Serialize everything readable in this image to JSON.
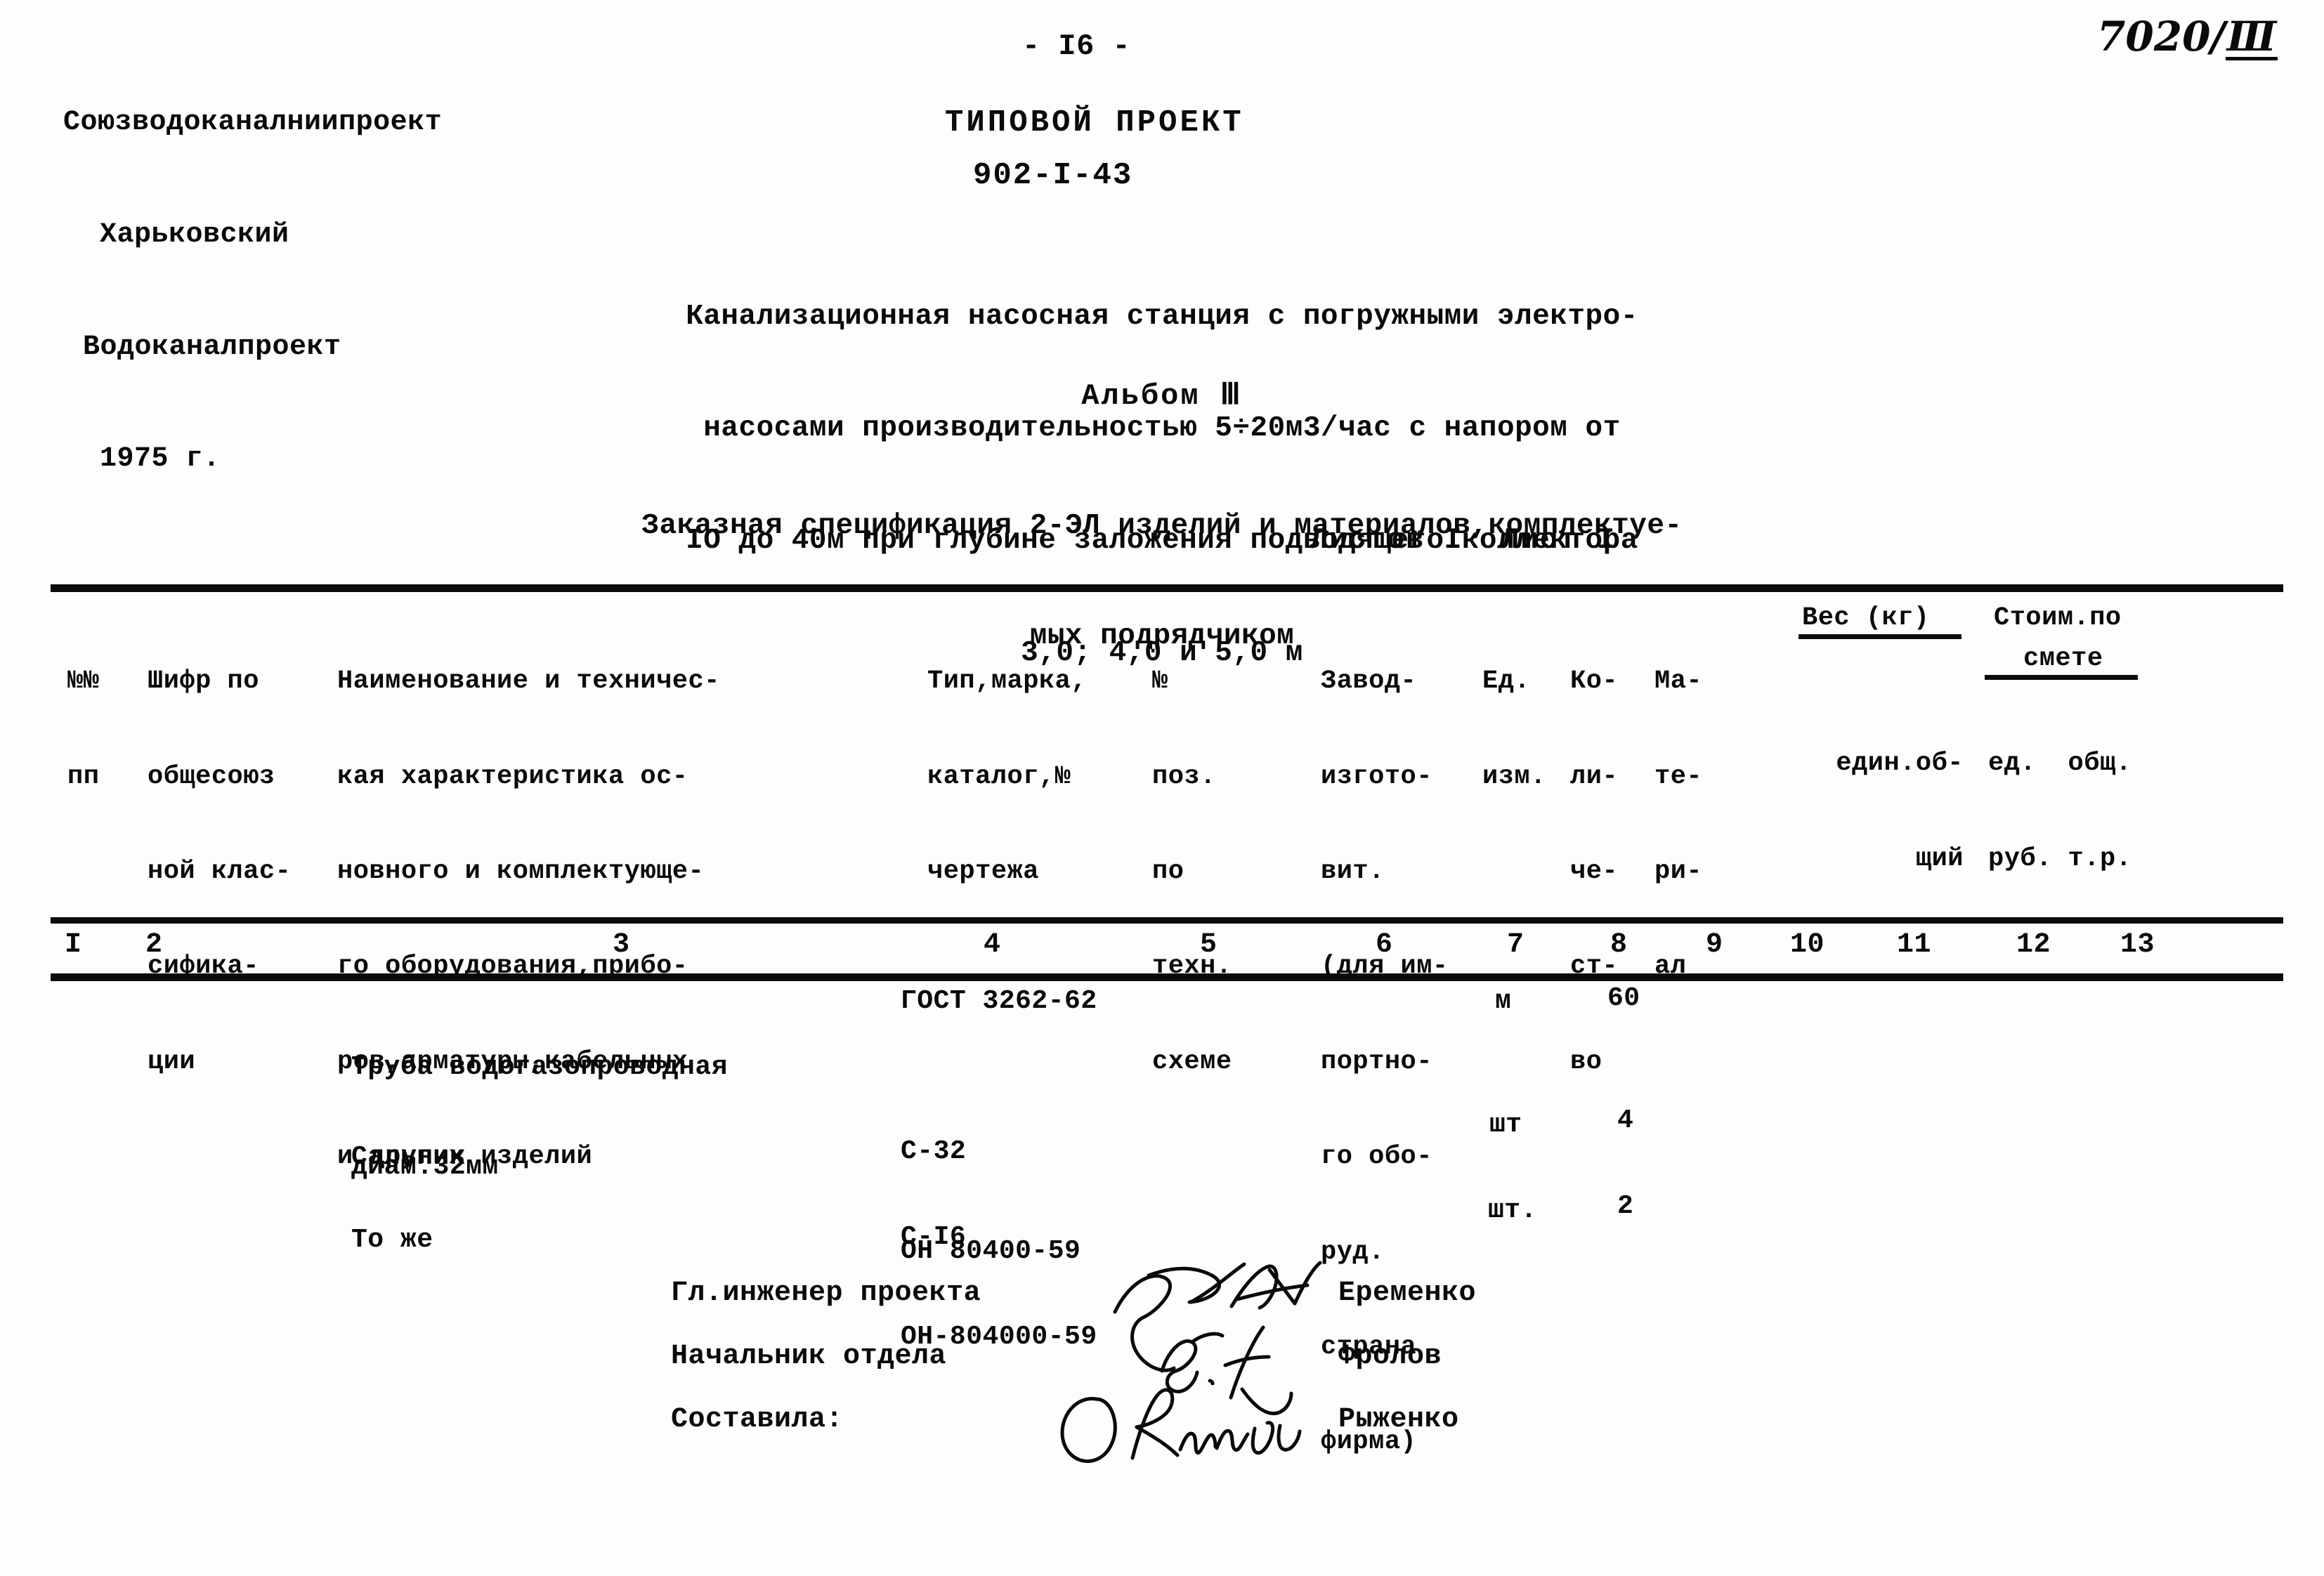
{
  "org": {
    "line1": "Союзводоканалниипроект",
    "line2": "Харьковский",
    "line3": "Водоканалпроект",
    "line4": "1975 г."
  },
  "header": {
    "page_number": "- I6 -",
    "doc_kind": "ТИПОВОЙ ПРОЕКТ",
    "doc_code": "902-I-43",
    "handwritten_number": "7020/",
    "handwritten_fraction_top": "Ⅲ",
    "description_lines": [
      "Канализационная насосная станция с погружными электро-",
      "насосами производительностью 5÷20м3/час с напором от",
      "IО до 40м при глубине заложения подводящего коллектора",
      "3,0; 4,0 и 5,0 м"
    ],
    "album": "Альбом Ⅲ",
    "spec_lines": [
      "Заказная спецификация 2-ЭЛ изделий и материалов,комплектуе-",
      "мых подрядчиком"
    ],
    "sheets": "Листов I  Лист I"
  },
  "table": {
    "columns": [
      {
        "num": "I",
        "header_lines": [
          "№№",
          "пп"
        ]
      },
      {
        "num": "2",
        "header_lines": [
          "Шифр по",
          "общесоюз",
          "ной клас-",
          "сифика-",
          "ции"
        ]
      },
      {
        "num": "3",
        "header_lines": [
          "Наименование и техничес-",
          "кая характеристика ос-",
          "новного и комплектующе-",
          "го оборудования,прибо-",
          "ров,арматуры,кабельных",
          "и других изделий"
        ]
      },
      {
        "num": "4",
        "header_lines": [
          "Тип,марка,",
          "каталог,№",
          "чертежа"
        ]
      },
      {
        "num": "5",
        "header_lines": [
          "№",
          "поз.",
          "по",
          "техн.",
          "схеме"
        ]
      },
      {
        "num": "6",
        "header_lines": [
          "Завод-",
          "изгото-",
          "вит.",
          "(для им-",
          "портно-",
          "го обо-",
          "руд.",
          "страна",
          "фирма)"
        ]
      },
      {
        "num": "7",
        "header_lines": [
          "Ед.",
          "изм."
        ]
      },
      {
        "num": "8",
        "header_lines": [
          "Ко-",
          "ли-",
          "че-",
          "ст-",
          "во"
        ]
      },
      {
        "num": "9",
        "header_lines": [
          "Ма-",
          "те-",
          "ри-",
          "ал"
        ]
      },
      {
        "num": "10",
        "header_lines": [
          "Вес (кг)"
        ],
        "sub": [
          "един.об-",
          "щий"
        ]
      },
      {
        "num": "11",
        "header_lines": []
      },
      {
        "num": "12",
        "header_lines": [
          "Стоим.по",
          "смете"
        ],
        "sub": [
          "ед.",
          "руб."
        ]
      },
      {
        "num": "13",
        "header_lines": [],
        "sub": [
          "общ.",
          "т.р."
        ]
      }
    ],
    "column_numbers": [
      "I",
      "2",
      "3",
      "4",
      "5",
      "6",
      "7",
      "8",
      "9",
      "10",
      "11",
      "12",
      "13"
    ],
    "rows": [
      {
        "name_lines": [
          "Труба водогазопроводная",
          "диам.32мм"
        ],
        "type_lines": [
          "ГОСТ 3262-62"
        ],
        "unit": "м",
        "qty": "60"
      },
      {
        "name_lines": [
          "Сальник"
        ],
        "type_lines": [
          "С-32",
          "ОН 80400-59"
        ],
        "unit": "шт",
        "qty": "4"
      },
      {
        "name_lines": [
          "То же"
        ],
        "type_lines": [
          "С-I6",
          "ОН-804000-59"
        ],
        "unit": "шт.",
        "qty": "2"
      }
    ]
  },
  "signatures": [
    {
      "role": "Гл.инженер проекта",
      "name": "Еременко"
    },
    {
      "role": "Начальник отдела",
      "name": "Фролов"
    },
    {
      "role": "Составила:",
      "name": "Рыженко"
    }
  ]
}
